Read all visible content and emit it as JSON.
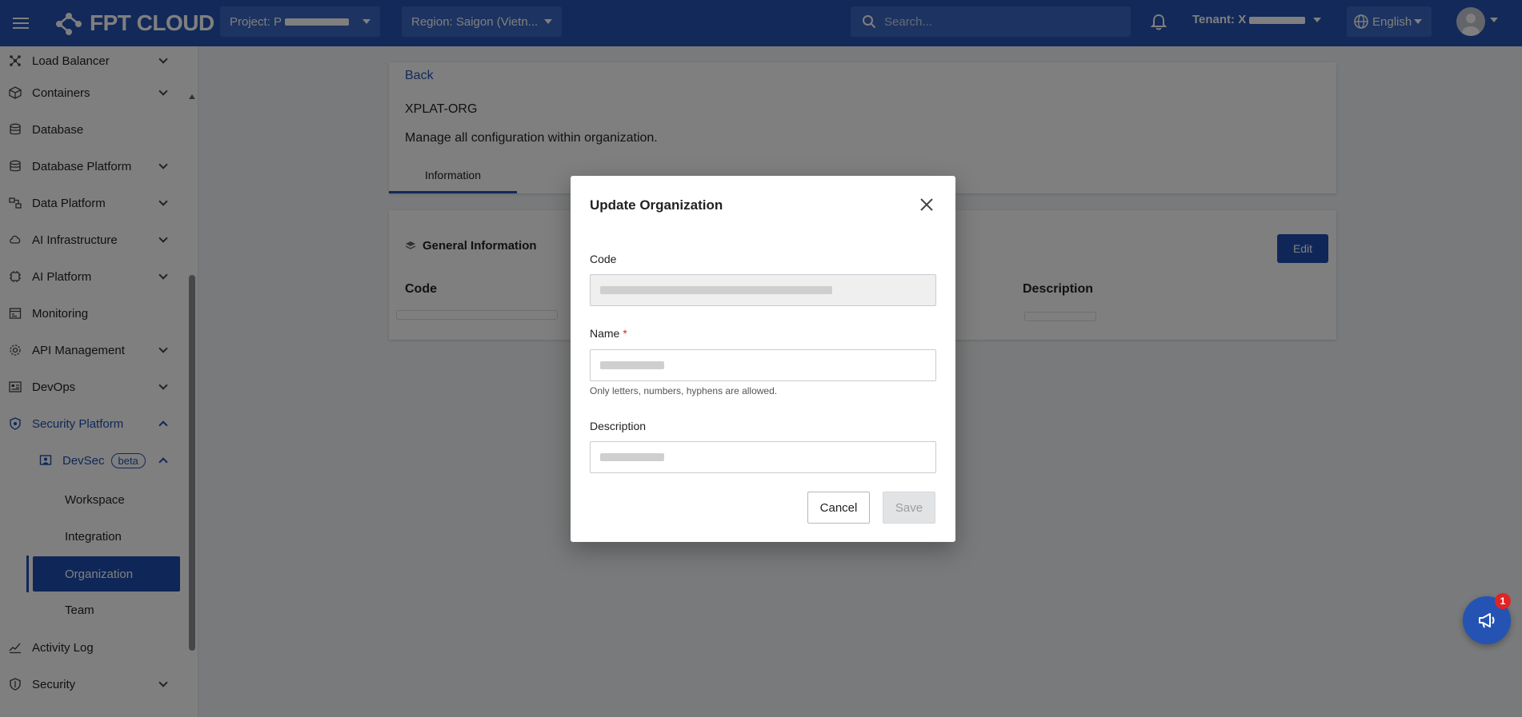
{
  "topbar": {
    "logo_text": "FPT CLOUD",
    "project_label": "Project: P",
    "region_label": "Region: Saigon (Vietn...",
    "search_placeholder": "Search...",
    "tenant_label": "Tenant: X",
    "language_label": "English"
  },
  "sidebar": {
    "items": [
      {
        "label": "Load Balancer",
        "icon": "network-icon"
      },
      {
        "label": "Containers",
        "icon": "cube-icon"
      },
      {
        "label": "Database",
        "icon": "database-icon"
      },
      {
        "label": "Database Platform",
        "icon": "database-icon"
      },
      {
        "label": "Data Platform",
        "icon": "data-platform-icon"
      },
      {
        "label": "AI Infrastructure",
        "icon": "cloud-ai-icon"
      },
      {
        "label": "AI Platform",
        "icon": "chip-icon"
      },
      {
        "label": "Monitoring",
        "icon": "monitor-icon"
      },
      {
        "label": "API Management",
        "icon": "gear-icon"
      },
      {
        "label": "DevOps",
        "icon": "devops-icon"
      },
      {
        "label": "Security Platform",
        "icon": "shield-icon"
      },
      {
        "label": "Activity Log",
        "icon": "activity-icon"
      },
      {
        "label": "Security",
        "icon": "shield-icon"
      }
    ],
    "devsec": {
      "label": "DevSec",
      "badge": "beta"
    },
    "devsec_children": [
      "Workspace",
      "Integration",
      "Organization",
      "Team"
    ]
  },
  "main": {
    "back_label": "Back",
    "org_title": "XPLAT-ORG",
    "org_description": "Manage all configuration within organization.",
    "tab_label": "Information",
    "general_info_title": "General Information",
    "edit_label": "Edit",
    "columns": [
      "Code",
      "Description"
    ]
  },
  "modal": {
    "title": "Update Organization",
    "code_label": "Code",
    "name_label": "Name",
    "required_mark": "*",
    "name_hint": "Only letters, numbers, hyphens are allowed.",
    "description_label": "Description",
    "cancel_label": "Cancel",
    "save_label": "Save"
  },
  "notification_badge": "1",
  "colors": {
    "brand": "#2453b3",
    "active": "#1f4fb0",
    "required": "#e02424"
  }
}
